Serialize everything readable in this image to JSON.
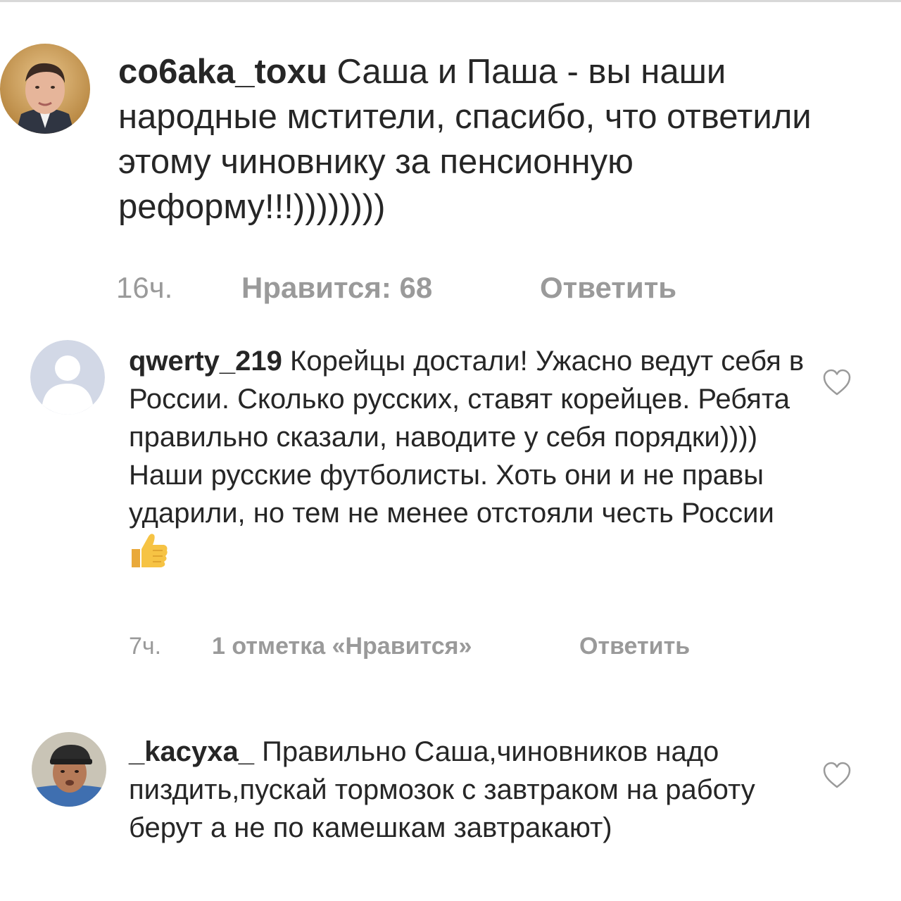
{
  "comments": [
    {
      "username": "со6aka_toxu",
      "text": "Саша и Паша - вы наши народные мстители, спасибо, что ответили этому чиновнику за пенсионную реформу!!!))))))))",
      "time": "16ч.",
      "likes": "Нравится: 68",
      "reply": "Ответить",
      "avatar": "user-photo-man-in-suit"
    },
    {
      "username": "qwerty_219",
      "text": "Корейцы достали! Ужасно ведут себя в России. Сколько русских, ставят корейцев. Ребята правильно сказали, наводите у себя порядки)))) Наши русские футболисты. Хоть они и не правы ударили, но тем не менее отстояли честь России",
      "emoji": "thumbs-up",
      "time": "7ч.",
      "likes": "1 отметка «Нравится»",
      "reply": "Ответить",
      "avatar": "default-person-icon"
    },
    {
      "username": "_kacyxa_",
      "text": "Правильно Саша,чиновников надо пиздить,пускай тормозок с завтраком на работу берут а не по камешкам завтракают)",
      "avatar": "user-photo-man-in-cap"
    }
  ],
  "icons": {
    "like": "heart-outline-icon"
  },
  "colors": {
    "text": "#262626",
    "meta": "#9a9a9a",
    "placeholder_avatar_bg": "#d2d8e6"
  }
}
